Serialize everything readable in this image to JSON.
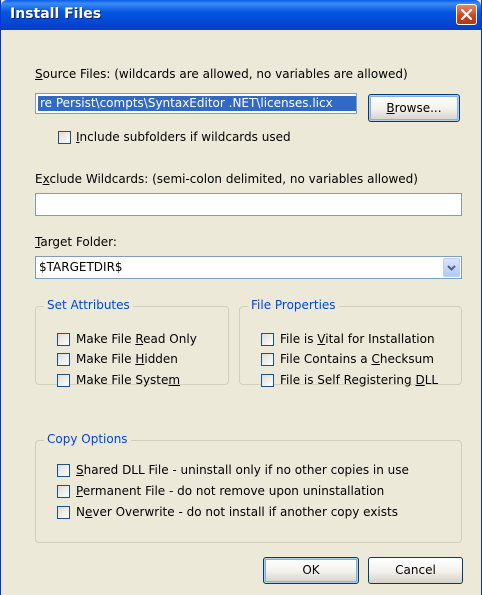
{
  "window": {
    "title": "Install Files"
  },
  "source": {
    "label_pre": "",
    "label_key": "S",
    "label_post": "ource Files: (wildcards are allowed, no variables are allowed)",
    "value": "re Persist\\compts\\SyntaxEditor .NET\\licenses.licx",
    "browse_key": "B",
    "browse_post": "rowse...",
    "subfolders_key": "I",
    "subfolders_post": "nclude subfolders if wildcards used"
  },
  "exclude": {
    "label_pre": "E",
    "label_key": "x",
    "label_post": "clude Wildcards: (semi-colon delimited, no variables allowed)",
    "value": ""
  },
  "target": {
    "label_key": "T",
    "label_post": "arget Folder:",
    "value": "$TARGETDIR$",
    "icon": "chevron-down-icon"
  },
  "set_attributes": {
    "legend": "Set Attributes",
    "items": [
      {
        "pre": "Make File ",
        "key": "R",
        "post": "ead Only"
      },
      {
        "pre": "Make File ",
        "key": "H",
        "post": "idden"
      },
      {
        "pre": "Make File Syste",
        "key": "m",
        "post": ""
      }
    ]
  },
  "file_properties": {
    "legend": "File Properties",
    "items": [
      {
        "pre": "File is ",
        "key": "V",
        "post": "ital for Installation"
      },
      {
        "pre": "File Contains a ",
        "key": "C",
        "post": "hecksum"
      },
      {
        "pre": "File is Self Registering ",
        "key": "D",
        "post": "LL"
      }
    ]
  },
  "copy_options": {
    "legend": "Copy Options",
    "items": [
      {
        "pre": "",
        "key": "S",
        "post": "hared DLL File - uninstall only if no other copies in use"
      },
      {
        "pre": "",
        "key": "P",
        "post": "ermanent File - do not remove upon uninstallation"
      },
      {
        "pre": "N",
        "key": "e",
        "post": "ver Overwrite - do not install if another copy exists"
      }
    ]
  },
  "buttons": {
    "ok": "OK",
    "cancel": "Cancel"
  },
  "colors": {
    "accent": "#0046d5",
    "title_bar": "#0556e0",
    "selection": "#316ac5"
  }
}
